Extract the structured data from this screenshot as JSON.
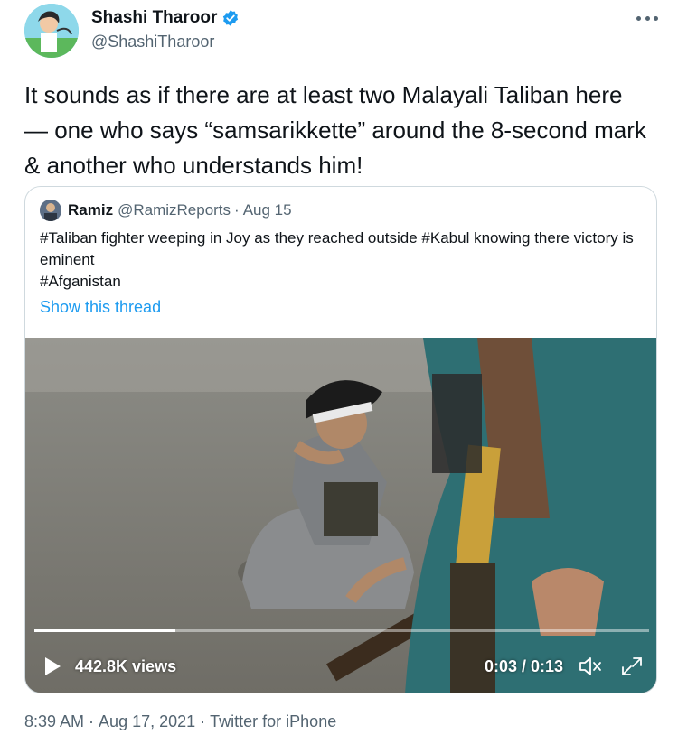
{
  "author": {
    "name": "Shashi Tharoor",
    "handle": "@ShashiTharoor",
    "verified": true
  },
  "tweet": {
    "text": "It sounds as if there are at least two Malayali Taliban here — one who says “samsarikkette” around the 8-second mark & another who understands him!"
  },
  "quoted": {
    "name": "Ramiz",
    "handle": "@RamizReports",
    "separator": "·",
    "date": "Aug 15",
    "lines": [
      "#Taliban fighter weeping in Joy as they reached outside #Kabul  knowing there victory is eminent",
      "#Afganistan"
    ],
    "show_thread": "Show this thread",
    "video": {
      "views": "442.8K views",
      "time": "0:03 / 0:13",
      "progress": 0.23
    }
  },
  "footer": {
    "time": "8:39 AM",
    "separator": "·",
    "date": "Aug 17, 2021",
    "source": "Twitter for iPhone"
  },
  "colors": {
    "accent": "#1d9bf0",
    "secondary_text": "#536471",
    "border": "#cfd9de"
  },
  "icons": [
    "more-icon",
    "verified-icon",
    "play-icon",
    "mute-icon",
    "fullscreen-icon"
  ]
}
